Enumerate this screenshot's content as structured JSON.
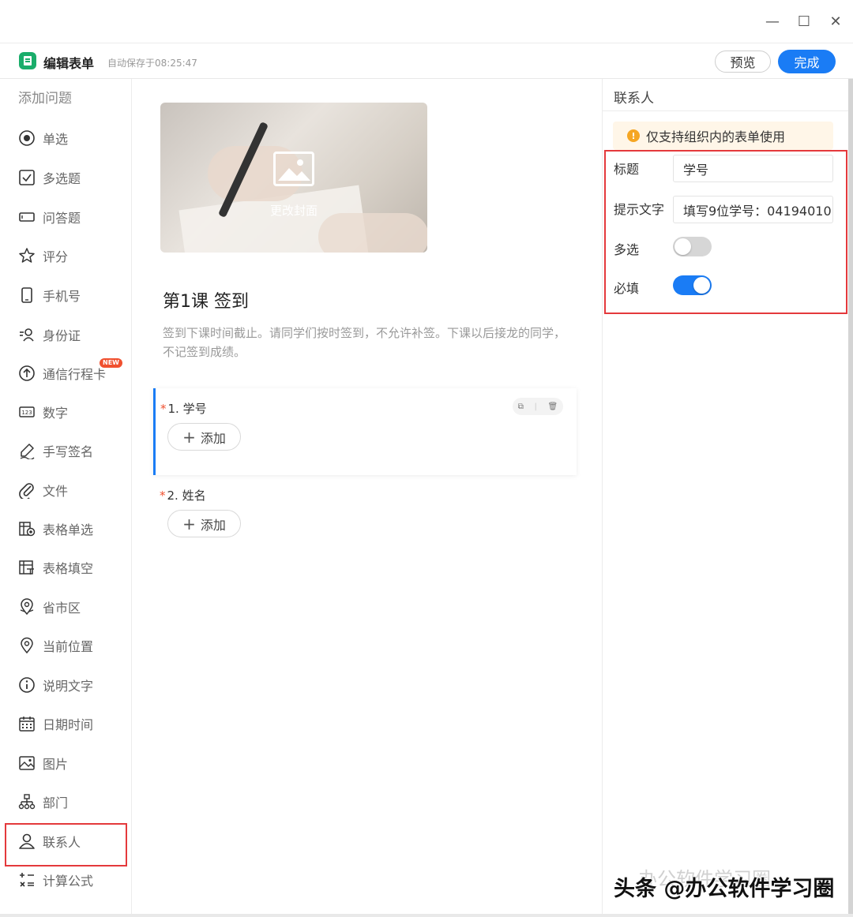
{
  "window": {
    "minimize_glyph": "—",
    "maximize_glyph": "☐",
    "close_glyph": "✕"
  },
  "header": {
    "title": "编辑表单",
    "autosave": "自动保存于08:25:47",
    "preview_label": "预览",
    "done_label": "完成",
    "accent": "#1a7cf5",
    "logo_color": "#1aad6b"
  },
  "sidebar": {
    "heading": "添加问题",
    "items": [
      {
        "label": "单选",
        "icon": "radio-icon"
      },
      {
        "label": "多选题",
        "icon": "checkbox-icon"
      },
      {
        "label": "问答题",
        "icon": "textbox-icon"
      },
      {
        "label": "评分",
        "icon": "star-icon"
      },
      {
        "label": "手机号",
        "icon": "phone-icon"
      },
      {
        "label": "身份证",
        "icon": "id-card-icon"
      },
      {
        "label": "通信行程卡",
        "icon": "upload-circle-icon",
        "badge": "NEW"
      },
      {
        "label": "数字",
        "icon": "number-icon"
      },
      {
        "label": "手写签名",
        "icon": "signature-icon"
      },
      {
        "label": "文件",
        "icon": "paperclip-icon"
      },
      {
        "label": "表格单选",
        "icon": "table-radio-icon"
      },
      {
        "label": "表格填空",
        "icon": "table-fill-icon"
      },
      {
        "label": "省市区",
        "icon": "map-icon"
      },
      {
        "label": "当前位置",
        "icon": "location-pin-icon"
      },
      {
        "label": "说明文字",
        "icon": "info-icon"
      },
      {
        "label": "日期时间",
        "icon": "calendar-icon"
      },
      {
        "label": "图片",
        "icon": "image-icon"
      },
      {
        "label": "部门",
        "icon": "org-chart-icon"
      },
      {
        "label": "联系人",
        "icon": "person-icon"
      },
      {
        "label": "计算公式",
        "icon": "formula-icon"
      }
    ]
  },
  "main": {
    "cover_label": "更改封面",
    "form_title": "第1课 签到",
    "form_desc": "签到下课时间截止。请同学们按时签到，不允许补签。下课以后接龙的同学，不记签到成绩。",
    "questions": [
      {
        "number": "1.",
        "label": "学号",
        "required": "*",
        "add_label": "添加"
      },
      {
        "number": "2.",
        "label": "姓名",
        "required": "*",
        "add_label": "添加"
      }
    ]
  },
  "panel": {
    "heading": "联系人",
    "notice": "仅支持组织内的表单使用",
    "title_label": "标题",
    "title_value": "学号",
    "hint_label": "提示文字",
    "hint_value": "填写9位学号：04194010",
    "multi_label": "多选",
    "multi_on": false,
    "required_label": "必填",
    "required_on": true
  },
  "watermark": {
    "text": "头条 @办公软件学习圈",
    "faint": "办公软件学习圈"
  }
}
